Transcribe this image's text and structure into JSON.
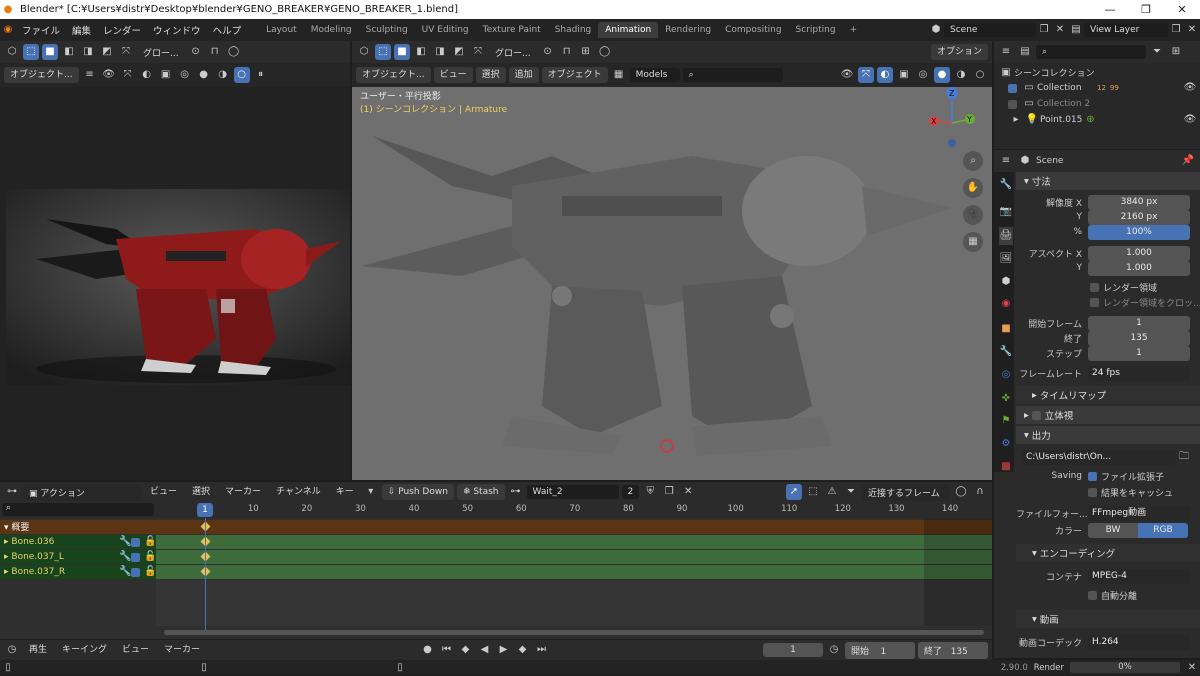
{
  "titlebar": {
    "title": "Blender* [C:¥Users¥distr¥Desktop¥blender¥GENO_BREAKER¥GENO_BREAKER_1.blend]",
    "minimize": "—",
    "maximize": "❐",
    "close": "✕"
  },
  "menu": [
    "ファイル",
    "編集",
    "レンダー",
    "ウィンドウ",
    "ヘルプ"
  ],
  "workspaces": [
    "Layout",
    "Modeling",
    "Sculpting",
    "UV Editing",
    "Texture Paint",
    "Shading",
    "Animation",
    "Rendering",
    "Compositing",
    "Scripting",
    "+"
  ],
  "active_workspace": "Animation",
  "scene_field": "Scene",
  "view_layer_field": "View Layer",
  "left_view": {
    "mode_label": "オブジェクト...",
    "pivot_label": "グロー..."
  },
  "main_view": {
    "pivot_label": "グロー...",
    "options_label": "オプション",
    "mode_label": "オブジェクト...",
    "menus": [
      "ビュー",
      "選択",
      "追加",
      "オブジェクト"
    ],
    "collection_filter": "Models",
    "overlay_title": "ユーザー・平行投影",
    "overlay_sub": "(1) シーンコレクション | Armature",
    "axis_x": "X",
    "axis_y": "Y",
    "axis_z": "Z"
  },
  "outliner": {
    "root": "シーンコレクション",
    "items": [
      "Collection",
      "Collection 2",
      "Point.015"
    ],
    "collection_badge": "12",
    "collection_badge2": "99"
  },
  "properties": {
    "context": "Scene",
    "sections": {
      "dimensions": "寸法",
      "time_remap": "タイムリマップ",
      "stereo": "立体視",
      "output": "出力",
      "encoding": "エンコーディング",
      "video": "動画"
    },
    "rows": [
      {
        "label": "解像度 X",
        "value": "3840 px"
      },
      {
        "label": "Y",
        "value": "2160 px"
      },
      {
        "label": "%",
        "value": "100%"
      },
      {
        "label": "アスペクト X",
        "value": "1.000"
      },
      {
        "label": "Y",
        "value": "1.000"
      },
      {
        "label": "開始フレーム",
        "value": "1"
      },
      {
        "label": "終了",
        "value": "135"
      },
      {
        "label": "ステップ",
        "value": "1"
      }
    ],
    "render_region": "レンダー領域",
    "crop": "レンダー領域をクロッ...",
    "framerate_label": "フレームレート",
    "framerate": "24 fps",
    "output_path": "C:\\Users\\distr\\On...",
    "saving_label": "Saving",
    "file_ext": "ファイル拡張子",
    "cache": "結果をキャッシュ",
    "file_format_label": "ファイルフォー...",
    "file_format": "FFmpeg動画",
    "color_label": "カラー",
    "color_bw": "BW",
    "color_rgb": "RGB",
    "container_label": "コンテナ",
    "container": "MPEG-4",
    "autosplit": "自動分離",
    "codec_label": "動画コーデック",
    "codec": "H.264"
  },
  "dopesheet": {
    "mode": "アクション",
    "menus": [
      "ビュー",
      "選択",
      "マーカー",
      "チャンネル",
      "キー"
    ],
    "push_down": "Push Down",
    "stash": "Stash",
    "action_name": "Wait_2",
    "users": "2",
    "snap": "近接するフレーム",
    "summary": "概要",
    "channels": [
      "Bone.036",
      "Bone.037_L",
      "Bone.037_R"
    ],
    "ticks": [
      "10",
      "20",
      "30",
      "40",
      "50",
      "60",
      "70",
      "80",
      "90",
      "100",
      "110",
      "120",
      "130",
      "140"
    ],
    "current_frame": "1"
  },
  "timeline": {
    "play": "再生",
    "keying": "キーイング",
    "view": "ビュー",
    "marker": "マーカー",
    "frame": "1",
    "start_label": "開始",
    "start": "1",
    "end_label": "終了",
    "end": "135"
  },
  "status": {
    "version": "2.90.0",
    "render_label": "Render",
    "progress_text": "0%",
    "progress": 0
  }
}
